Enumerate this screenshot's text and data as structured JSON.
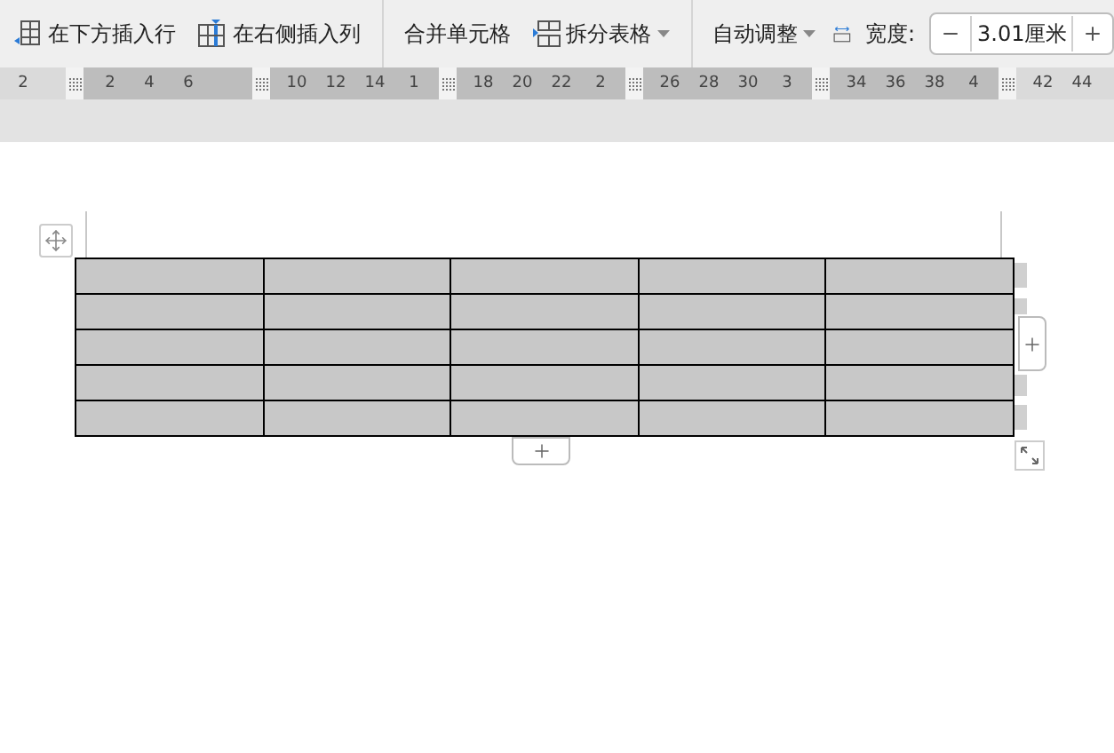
{
  "toolbar": {
    "items": [
      {
        "kind": "button",
        "label": "在下方插入行"
      },
      {
        "kind": "button",
        "label": "在右侧插入列"
      },
      {
        "kind": "separator"
      },
      {
        "kind": "button",
        "label": "合并单元格"
      },
      {
        "kind": "dropdown",
        "label": "拆分表格"
      },
      {
        "kind": "separator"
      },
      {
        "kind": "dropdown",
        "label": "自动调整"
      },
      {
        "kind": "width",
        "label": "宽度:",
        "value": "3.01厘米"
      }
    ]
  },
  "ruler": {
    "segments": [
      {
        "shaded": false,
        "labels": [
          "2"
        ]
      },
      {
        "shaded": true,
        "labels": [
          "2",
          "4",
          "6"
        ]
      },
      {
        "shaded": true,
        "labels": [
          "10",
          "12",
          "14",
          "1"
        ]
      },
      {
        "shaded": true,
        "labels": [
          "18",
          "20",
          "22",
          "2"
        ]
      },
      {
        "shaded": true,
        "labels": [
          "26",
          "28",
          "30",
          "3"
        ]
      },
      {
        "shaded": true,
        "labels": [
          "34",
          "36",
          "38",
          "4"
        ]
      },
      {
        "shaded": false,
        "labels": [
          "42",
          "44"
        ]
      }
    ]
  },
  "table": {
    "rows": [
      {
        "cells": [
          {
            "selected": true
          },
          {
            "selected": true
          },
          {
            "selected": true
          },
          {
            "selected": true
          },
          {
            "selected": true
          }
        ]
      },
      {
        "cells": [
          {
            "selected": true
          },
          {
            "selected": true
          },
          {
            "selected": true
          },
          {
            "selected": true
          },
          {
            "selected": true
          }
        ]
      },
      {
        "cells": [
          {
            "selected": true
          },
          {
            "selected": true
          },
          {
            "selected": true
          },
          {
            "selected": true
          },
          {
            "selected": true
          }
        ]
      },
      {
        "cells": [
          {
            "selected": true
          },
          {
            "selected": true
          },
          {
            "selected": true
          },
          {
            "selected": true
          },
          {
            "selected": true
          }
        ]
      },
      {
        "cells": [
          {
            "selected": true
          },
          {
            "selected": true
          },
          {
            "selected": true
          },
          {
            "selected": true
          },
          {
            "selected": true
          }
        ]
      }
    ]
  }
}
